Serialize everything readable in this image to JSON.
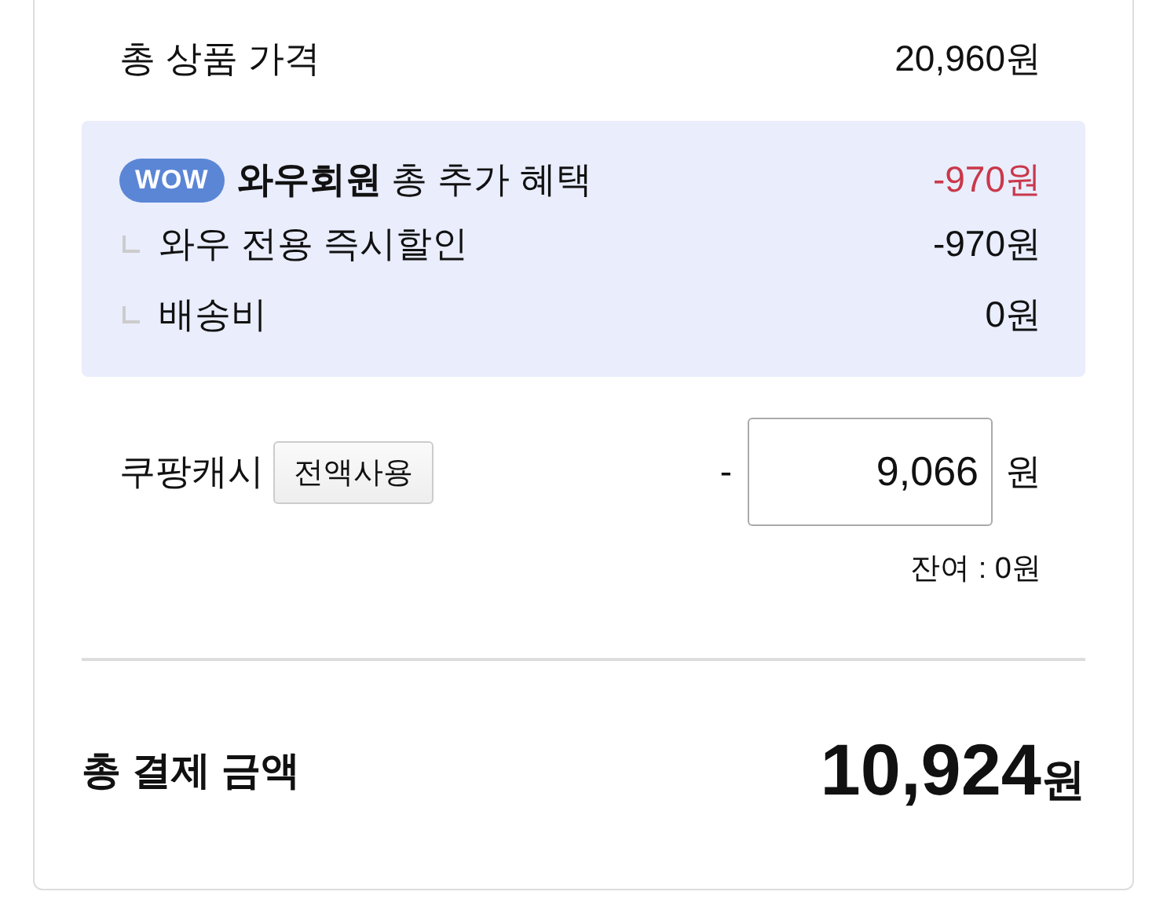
{
  "subtotal": {
    "label": "총 상품 가격",
    "amount": "20,960원"
  },
  "benefits": {
    "badge": "WOW",
    "label": "**와우회원** 총 추가 혜택",
    "amount": "-970원",
    "items": [
      {
        "label": "와우 전용 즉시할인",
        "amount": "-970원"
      },
      {
        "label": "배송비",
        "amount": "0원"
      }
    ]
  },
  "cash": {
    "label": "쿠팡캐시",
    "button": "전액사용",
    "minus": "-",
    "value": "9,066",
    "unit": "원",
    "remainder": "잔여 : 0원"
  },
  "total": {
    "label": "총 결제 금액",
    "amount": "10,924",
    "unit": "원"
  }
}
